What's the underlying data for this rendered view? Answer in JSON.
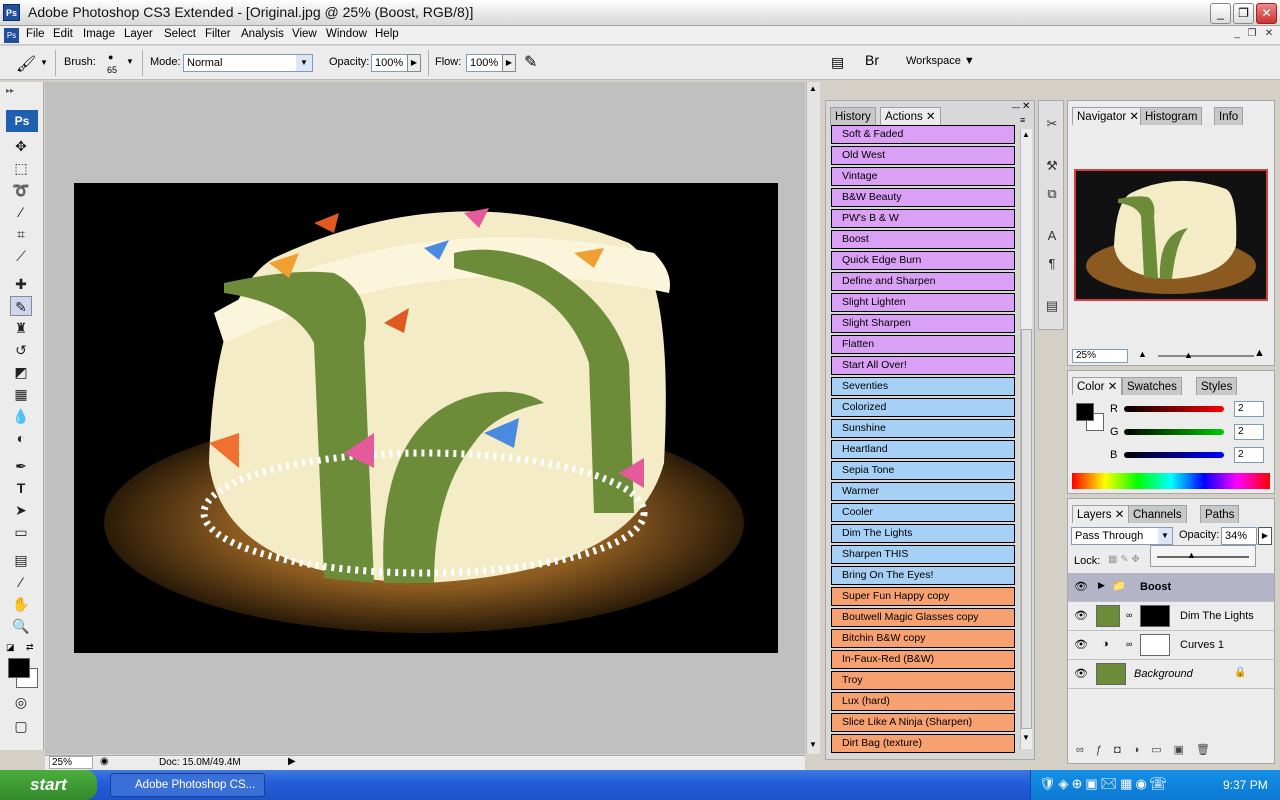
{
  "window": {
    "title": "Adobe Photoshop CS3 Extended - [Original.jpg @ 25% (Boost, RGB/8)]",
    "app_badge": "Ps"
  },
  "menu": [
    "File",
    "Edit",
    "Image",
    "Layer",
    "Select",
    "Filter",
    "Analysis",
    "View",
    "Window",
    "Help"
  ],
  "options": {
    "brush_label": "Brush:",
    "brush_size": "65",
    "mode_label": "Mode:",
    "mode_value": "Normal",
    "opacity_label": "Opacity:",
    "opacity_value": "100%",
    "flow_label": "Flow:",
    "flow_value": "100%",
    "workspace_label": "Workspace"
  },
  "toolbox": {
    "badge": "Ps"
  },
  "status": {
    "zoom": "25%",
    "doc": "Doc: 15.0M/49.4M"
  },
  "actions_panel": {
    "tabs": [
      "History",
      "Actions"
    ],
    "items": [
      {
        "label": "Soft & Faded",
        "color": "purple"
      },
      {
        "label": "Old West",
        "color": "purple"
      },
      {
        "label": "Vintage",
        "color": "purple"
      },
      {
        "label": "B&W Beauty",
        "color": "purple"
      },
      {
        "label": "PW's B & W",
        "color": "purple"
      },
      {
        "label": "Boost",
        "color": "purple"
      },
      {
        "label": "Quick Edge Burn",
        "color": "purple"
      },
      {
        "label": "Define and Sharpen",
        "color": "purple"
      },
      {
        "label": "Slight Lighten",
        "color": "purple"
      },
      {
        "label": "Slight Sharpen",
        "color": "purple"
      },
      {
        "label": "Flatten",
        "color": "purple"
      },
      {
        "label": "Start All Over!",
        "color": "purple"
      },
      {
        "label": "Seventies",
        "color": "blue"
      },
      {
        "label": "Colorized",
        "color": "blue"
      },
      {
        "label": "Sunshine",
        "color": "blue"
      },
      {
        "label": "Heartland",
        "color": "blue"
      },
      {
        "label": "Sepia Tone",
        "color": "blue"
      },
      {
        "label": "Warmer",
        "color": "blue"
      },
      {
        "label": "Cooler",
        "color": "blue"
      },
      {
        "label": "Dim The Lights",
        "color": "blue"
      },
      {
        "label": "Sharpen THIS",
        "color": "blue"
      },
      {
        "label": "Bring On The Eyes!",
        "color": "blue"
      },
      {
        "label": "Super Fun Happy copy",
        "color": "orange"
      },
      {
        "label": "Boutwell Magic Glasses copy",
        "color": "orange"
      },
      {
        "label": "Bitchin B&W copy",
        "color": "orange"
      },
      {
        "label": "In-Faux-Red (B&W)",
        "color": "orange"
      },
      {
        "label": "Troy",
        "color": "orange"
      },
      {
        "label": "Lux (hard)",
        "color": "orange"
      },
      {
        "label": "Slice Like A Ninja (Sharpen)",
        "color": "orange"
      },
      {
        "label": "Dirt Bag (texture)",
        "color": "orange"
      }
    ]
  },
  "navigator": {
    "tabs": [
      "Navigator",
      "Histogram",
      "Info"
    ],
    "zoom": "25%"
  },
  "color_panel": {
    "tabs": [
      "Color",
      "Swatches",
      "Styles"
    ],
    "channels": [
      {
        "label": "R",
        "value": "2"
      },
      {
        "label": "G",
        "value": "2"
      },
      {
        "label": "B",
        "value": "2"
      }
    ]
  },
  "layers_panel": {
    "tabs": [
      "Layers",
      "Channels",
      "Paths"
    ],
    "blend_mode": "Pass Through",
    "opacity_label": "Opacity:",
    "opacity_value": "34%",
    "lock_label": "Lock:",
    "layers": [
      {
        "name": "Boost"
      },
      {
        "name": "Dim The Lights"
      },
      {
        "name": "Curves 1"
      },
      {
        "name": "Background"
      }
    ]
  },
  "taskbar": {
    "start": "start",
    "item": "Adobe Photoshop CS...",
    "clock": "9:37 PM"
  },
  "colors": {
    "purple": "#d9a0f5",
    "blue": "#a6d0f5",
    "orange": "#f7a070"
  }
}
